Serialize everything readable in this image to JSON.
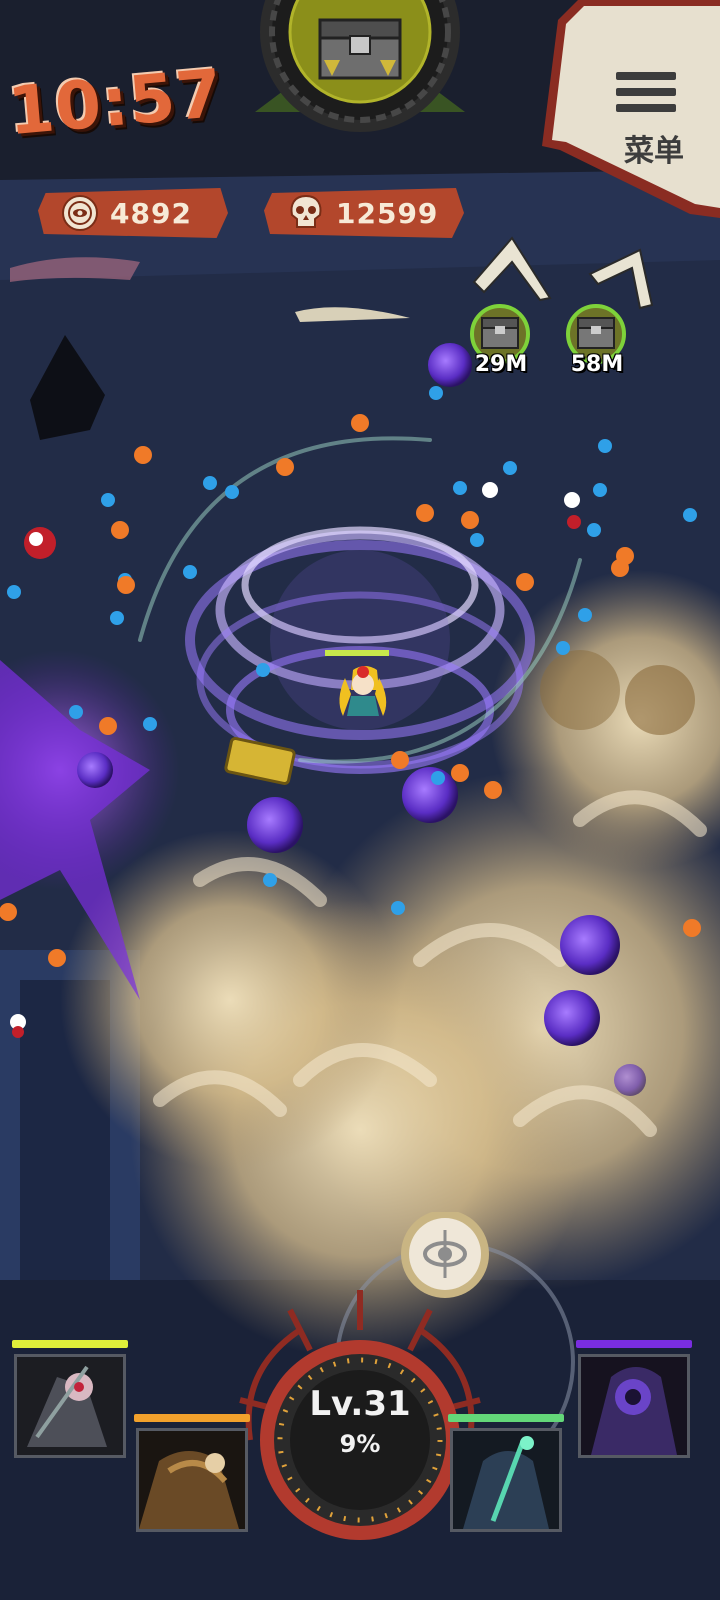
{
  "hud": {
    "timer": "10:57",
    "menu_label": "菜单",
    "coins": "4892",
    "kills": "12599",
    "chests": [
      {
        "label": "29M"
      },
      {
        "label": "58M"
      }
    ]
  },
  "player": {
    "level": "Lv.31",
    "exp_percent": "9%"
  },
  "heroes": [
    {
      "name": "hero-slot-1",
      "bar_color": "#e0ef3a"
    },
    {
      "name": "hero-slot-2",
      "bar_color": "#f2a12c"
    },
    {
      "name": "hero-slot-3",
      "bar_color": "#63d779"
    },
    {
      "name": "hero-slot-4",
      "bar_color": "#7a2de0"
    }
  ],
  "icons": [
    "coin-icon",
    "skull-icon",
    "menu-icon",
    "chest-icon",
    "joystick-icon"
  ],
  "colors": {
    "timer": "#e2683a",
    "banner": "#b3472c",
    "background": "#1f2840",
    "vortex": "#8a5fe0",
    "blast": "#e7d2a6"
  }
}
